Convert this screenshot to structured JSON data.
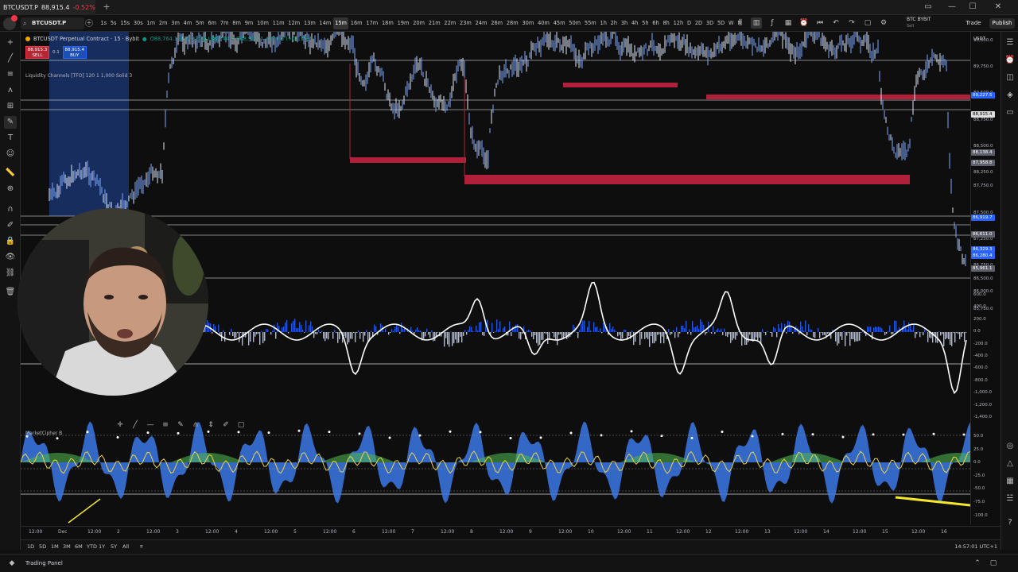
{
  "window": {
    "tab_symbol": "BTCUSDT.P",
    "tab_price": "88,915.4",
    "tab_change": "-0.52%",
    "controls": [
      "▭",
      "—",
      "☐",
      "✕"
    ]
  },
  "toolbar": {
    "symbol": "BTCUSDT.P",
    "timeframes": [
      "1s",
      "5s",
      "15s",
      "30s",
      "1m",
      "2m",
      "3m",
      "4m",
      "5m",
      "6m",
      "7m",
      "8m",
      "9m",
      "10m",
      "11m",
      "12m",
      "13m",
      "14m",
      "15m",
      "16m",
      "17m",
      "18m",
      "19m",
      "20m",
      "21m",
      "22m",
      "23m",
      "24m",
      "26m",
      "28m",
      "30m",
      "40m",
      "45m",
      "50m",
      "55m",
      "1h",
      "2h",
      "3h",
      "4h",
      "5h",
      "6h",
      "8h",
      "12h",
      "D",
      "2D",
      "3D",
      "5D",
      "W",
      "M"
    ],
    "active_timeframe": "15m",
    "exchange": "BTC BYBIT",
    "exchange_sub": "Sell",
    "trade_label": "Trade",
    "publish_label": "Publish"
  },
  "legend": {
    "title": "BTCUSDT Perpetual Contract · 15 · Bybit",
    "ohlc": "O88,764.1 H89,034.6 L88,744.2 C88,915.4 +151.3 (+0.17%)",
    "sell_price": "88,915.3",
    "sell_label": "SELL",
    "spread": "0.1",
    "buy_price": "88,915.4",
    "buy_label": "BUY",
    "indicator": "Liquidity Channels [TFO] 120 1 1,000 Solid 3",
    "market_cipher": "MarketCipher B"
  },
  "price_axis": {
    "currency": "USDT",
    "labels": [
      "90,000.0",
      "89,750.0",
      "89,500.0",
      "88,750.0",
      "88,500.0",
      "88,250.0",
      "87,750.0",
      "87,500.0",
      "87,250.0",
      "86,750.0",
      "86,500.0",
      "86,000.0",
      "85,750.0"
    ],
    "tags": [
      {
        "text": "89,227.5",
        "style": "blue"
      },
      {
        "text": "88,915.4",
        "style": "white"
      },
      {
        "text": "88,138.4",
        "style": "gray"
      },
      {
        "text": "87,958.8",
        "style": "gray"
      },
      {
        "text": "86,919.7",
        "style": "blue"
      },
      {
        "text": "86,611.0",
        "style": "gray"
      },
      {
        "text": "86,329.3",
        "style": "blue"
      },
      {
        "text": "86,280.4",
        "style": "blue"
      },
      {
        "text": "85,961.1",
        "style": "gray"
      }
    ],
    "osc_labels": [
      "600.0",
      "400.0",
      "200.0",
      "0.0",
      "-200.0",
      "-400.0",
      "-600.0",
      "-800.0",
      "-1,000.0",
      "-1,200.0",
      "-1,400.0"
    ],
    "mc_labels": [
      "50.0",
      "25.0",
      "0.0",
      "-25.0",
      "-50.0",
      "-75.0",
      "-100.0"
    ]
  },
  "time_axis": {
    "ticks": [
      "12:00",
      "Dec",
      "12:00",
      "2",
      "12:00",
      "3",
      "12:00",
      "4",
      "12:00",
      "5",
      "12:00",
      "6",
      "12:00",
      "7",
      "12:00",
      "8",
      "12:00",
      "9",
      "12:00",
      "10",
      "12:00",
      "11",
      "12:00",
      "12",
      "12:00",
      "13",
      "12:00",
      "14",
      "12:00",
      "15",
      "12:00",
      "16"
    ]
  },
  "range_bar": {
    "ranges": [
      "1D",
      "5D",
      "1M",
      "3M",
      "6M",
      "YTD",
      "1Y",
      "5Y",
      "All"
    ],
    "clock": "14:57:01 UTC+1"
  },
  "bottom_bar": {
    "trading_panel": "Trading Panel"
  },
  "colors": {
    "background": "#0e0e0e",
    "accent": "#2962ff",
    "down": "#f23645",
    "up": "#089981",
    "liquidity_zone": "#b0203a"
  }
}
